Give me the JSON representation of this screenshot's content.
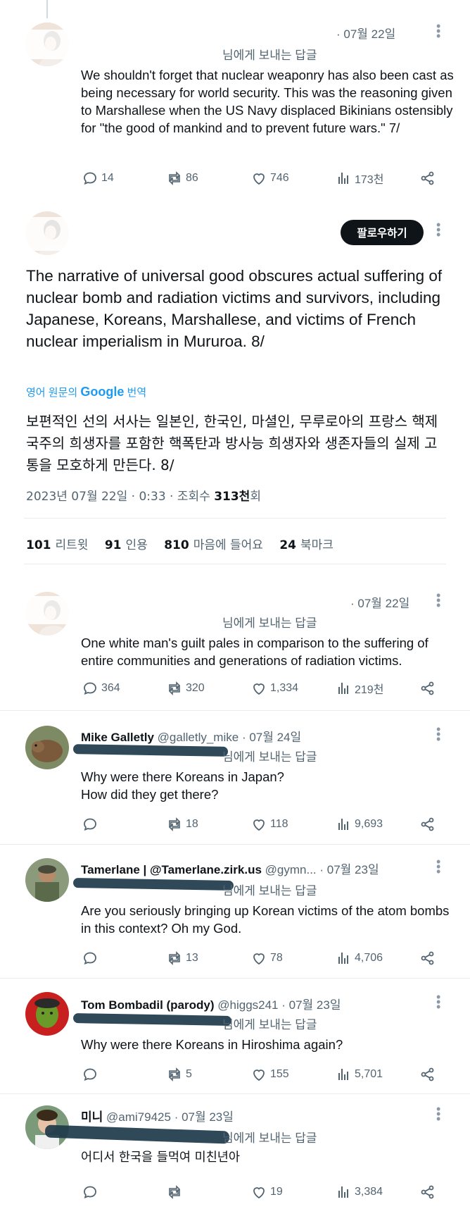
{
  "tweets": [
    {
      "name": "",
      "date": "· 07월 22일",
      "reply_suffix": "님에게 보내는 답글",
      "text": "We shouldn't forget that nuclear weaponry has also been cast as being necessary for world security. This was the reasoning given to Marshallese when the US Navy displaced Bikinians ostensibly for \"the good of mankind and to prevent future wars.\" 7/",
      "replies": "14",
      "retweets": "86",
      "likes": "746",
      "views": "173천"
    },
    {
      "name": "Mike Galletly",
      "handle": "@galletly_mike",
      "date": "· 07월 24일",
      "reply_suffix": "님에게 보내는 답글",
      "text": "Why were there Koreans in Japan?\nHow did they get there?",
      "replies": "",
      "retweets": "18",
      "likes": "118",
      "views": "9,693"
    },
    {
      "name": "Tamerlane | @Tamerlane.zirk.us",
      "handle": "@gymn...",
      "date": "· 07월 23일",
      "reply_suffix": "님에게 보내는 답글",
      "text": "Are you seriously bringing up Korean victims of the atom bombs in this context? Oh my God.",
      "replies": "",
      "retweets": "13",
      "likes": "78",
      "views": "4,706"
    },
    {
      "name": "Tom Bombadil (parody)",
      "handle": "@higgs241",
      "date": "· 07월 23일",
      "reply_suffix": "님에게 보내는 답글",
      "text": "Why were there Koreans in Hiroshima again?",
      "replies": "",
      "retweets": "5",
      "likes": "155",
      "views": "5,701"
    },
    {
      "name": "미니",
      "handle": "@ami79425",
      "date": "· 07월 23일",
      "reply_suffix": "님에게 보내는 답글",
      "text": "어디서 한국을 들먹여 미친년아",
      "replies": "",
      "retweets": "",
      "likes": "19",
      "views": "3,384"
    }
  ],
  "main_tweet": {
    "follow_label": "팔로우하기",
    "text": "The narrative of universal good obscures actual suffering of nuclear bomb and radiation victims and survivors, including Japanese, Koreans, Marshallese, and victims of French nuclear imperialism in Mururoa. 8/",
    "translate_prefix": "영어 원문의",
    "translate_brand": "Google",
    "translate_suffix": "번역",
    "translation": "보편적인 선의 서사는 일본인, 한국인, 마셜인, 무루로아의 프랑스 핵제국주의 희생자를 포함한 핵폭탄과 방사능 희생자와 생존자들의 실제 고통을 모호하게 만든다. 8/",
    "timestamp": "2023년 07월 22일 · 0:33 · 조회수",
    "views_value": "313천",
    "views_suffix": "회",
    "stats": {
      "retweets_value": "101",
      "retweets_label": "리트윗",
      "quotes_value": "91",
      "quotes_label": "인용",
      "likes_value": "810",
      "likes_label": "마음에 들어요",
      "bookmarks_value": "24",
      "bookmarks_label": "북마크"
    }
  },
  "reply_self": {
    "date": "· 07월 22일",
    "reply_suffix": "님에게 보내는 답글",
    "text": "One white man's guilt pales in comparison to the suffering of entire communities and generations of radiation victims.",
    "replies": "364",
    "retweets": "320",
    "likes": "1,334",
    "views": "219천"
  },
  "icons": {
    "reply": "speech-bubble-icon",
    "retweet": "retweet-arrows-icon",
    "like": "heart-icon",
    "views": "bar-chart-icon",
    "share": "share-nodes-icon",
    "more": "vertical-dots-icon"
  },
  "colors": {
    "link": "#1d9bf0",
    "muted": "#536471",
    "text": "#0f1419",
    "redaction": "#1e3a4a"
  }
}
